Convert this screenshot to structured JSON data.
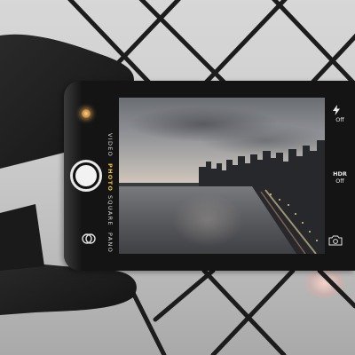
{
  "camera_ui": {
    "modes": [
      {
        "label": "VIDEO",
        "active": false
      },
      {
        "label": "PHOTO",
        "active": true
      },
      {
        "label": "SQUARE",
        "active": false
      },
      {
        "label": "PANO",
        "active": false
      }
    ],
    "flash": {
      "icon": "lightning-bolt-icon",
      "state": "Off"
    },
    "hdr": {
      "title": "HDR",
      "state": "Off"
    },
    "switch_camera_icon": "camera-switch-icon",
    "shutter_icon": "shutter-button-icon",
    "filters_icon": "filters-icon",
    "active_mode_color": "#f0c044"
  },
  "scene": {
    "phone_color": "#141414",
    "water_color": "#5d5e62"
  }
}
